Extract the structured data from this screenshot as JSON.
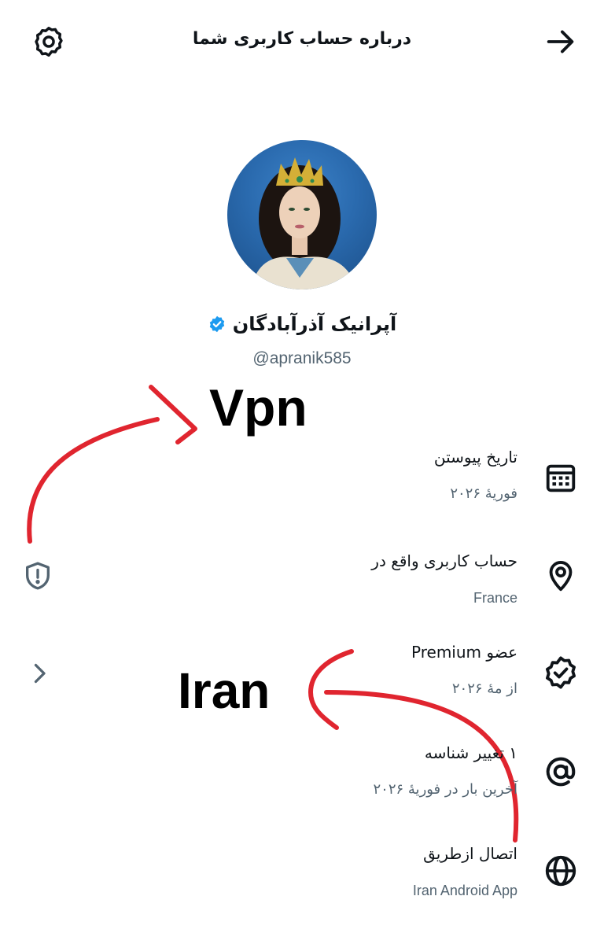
{
  "header": {
    "title": "درباره حساب کاربری شما",
    "settings_icon": "gear-icon",
    "forward_icon": "arrow-right-icon"
  },
  "profile": {
    "display_name": "آپرانیک آذرآبادگان",
    "handle": "@apranik585",
    "verified_badge_color": "#1d9bf0"
  },
  "annotations": {
    "vpn_label": "Vpn",
    "iran_label": "Iran",
    "arrow_color": "#e0252f"
  },
  "info_rows": [
    {
      "title": "تاریخ پیوستن",
      "value": "فوریهٔ ۲۰۲۶",
      "icon": "calendar-icon"
    },
    {
      "title": "حساب کاربری واقع در",
      "value": "France",
      "icon": "location-pin-icon"
    },
    {
      "title": "عضو Premium",
      "value": "از مهٔ ۲۰۲۶",
      "icon": "verified-badge-icon"
    },
    {
      "title": "۱ تغییر شناسه",
      "value": "آخرین بار در فوریهٔ ۲۰۲۶",
      "icon": "at-icon"
    },
    {
      "title": "اتصال ازطریق",
      "value": "Iran Android App",
      "icon": "globe-icon"
    }
  ],
  "side": {
    "shield_icon": "shield-alert-icon",
    "chevron_icon": "chevron-right-icon"
  },
  "colors": {
    "text_primary": "#0f1419",
    "text_secondary": "#536471",
    "background": "#ffffff"
  }
}
